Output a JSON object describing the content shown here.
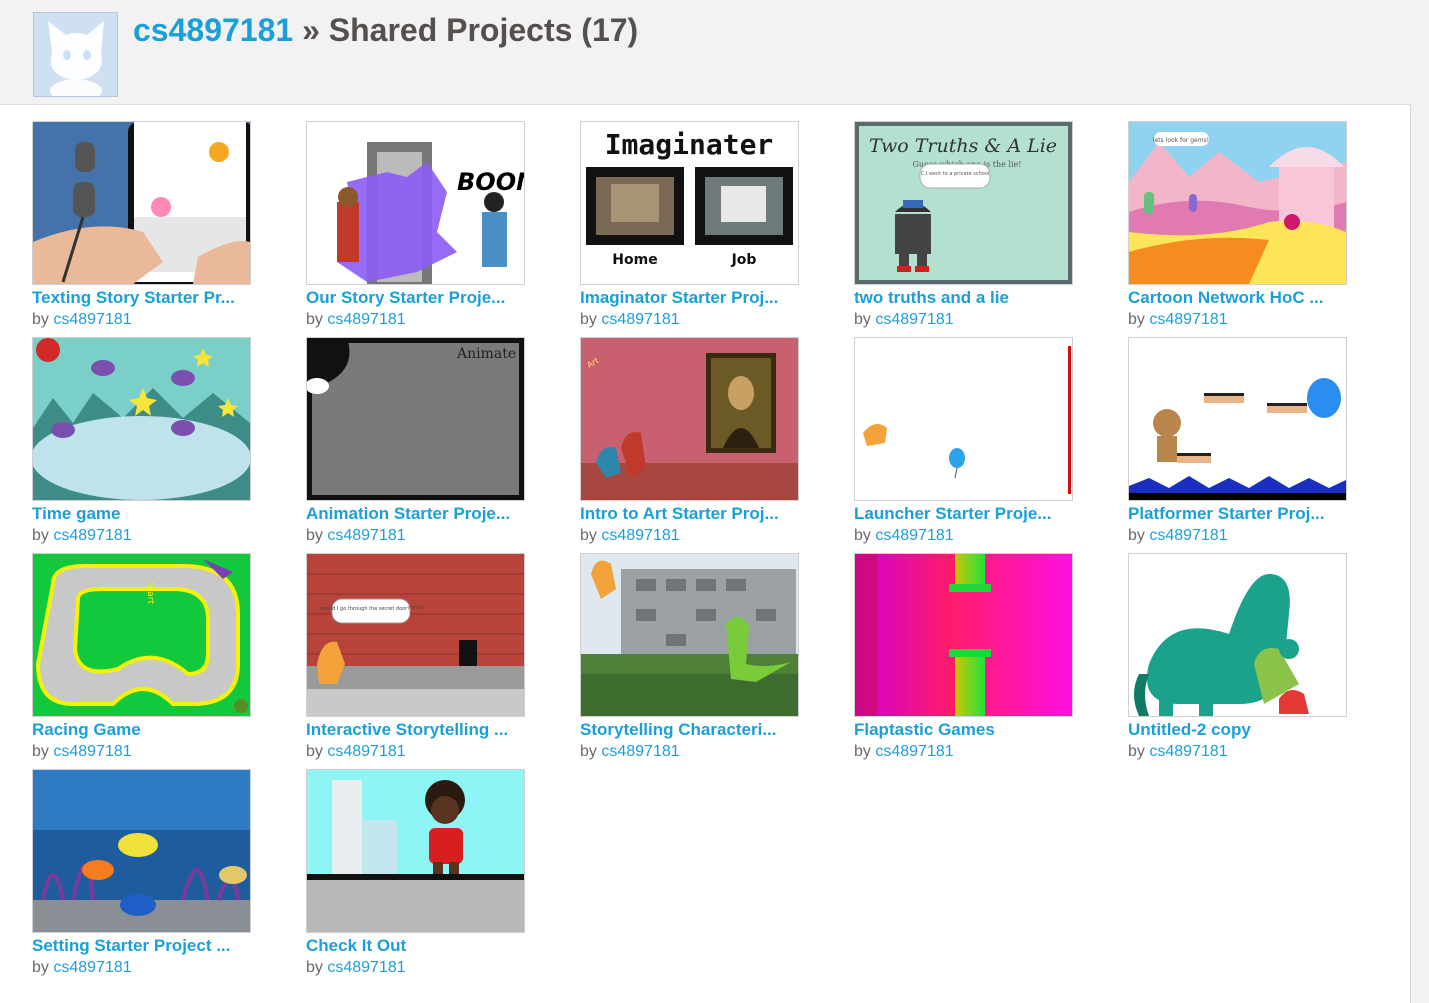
{
  "header": {
    "username": "cs4897181",
    "separator": " » ",
    "section_title": "Shared Projects (17)"
  },
  "by_label": "by",
  "projects": [
    {
      "title": "Texting Story Starter Pr...",
      "author": "cs4897181"
    },
    {
      "title": "Our Story Starter Proje...",
      "author": "cs4897181"
    },
    {
      "title": "Imaginator Starter Proj...",
      "author": "cs4897181"
    },
    {
      "title": "two truths and a lie",
      "author": "cs4897181"
    },
    {
      "title": "Cartoon Network HoC ...",
      "author": "cs4897181"
    },
    {
      "title": "Time game",
      "author": "cs4897181"
    },
    {
      "title": "Animation Starter Proje...",
      "author": "cs4897181"
    },
    {
      "title": "Intro to Art Starter Proj...",
      "author": "cs4897181"
    },
    {
      "title": "Launcher Starter Proje...",
      "author": "cs4897181"
    },
    {
      "title": "Platformer Starter Proj...",
      "author": "cs4897181"
    },
    {
      "title": "Racing Game",
      "author": "cs4897181"
    },
    {
      "title": "Interactive Storytelling ...",
      "author": "cs4897181"
    },
    {
      "title": "Storytelling Characteri...",
      "author": "cs4897181"
    },
    {
      "title": "Flaptastic Games",
      "author": "cs4897181"
    },
    {
      "title": "Untitled-2 copy",
      "author": "cs4897181"
    },
    {
      "title": "Setting Starter Project ...",
      "author": "cs4897181"
    },
    {
      "title": "Check It Out",
      "author": "cs4897181"
    }
  ],
  "thumbnail_texts": {
    "imaginator_heading": "Imaginater",
    "imaginator_home": "Home",
    "imaginator_job": "Job",
    "truths_heading": "Two Truths & A Lie",
    "truths_subheading": "Guess which one is the lie!",
    "truths_bubble": "C.I went to a private school",
    "animate_label": "Animate",
    "boom_label": "BOOM",
    "art_label": "Art",
    "start_label": "Start",
    "door_bubble": "should I go through the secret door??????",
    "cartoon_bubble": "lets look for gems!"
  },
  "colors": {
    "link": "#1aa0d8",
    "title_text": "#554f4d",
    "header_bg": "#f2f2f2"
  }
}
